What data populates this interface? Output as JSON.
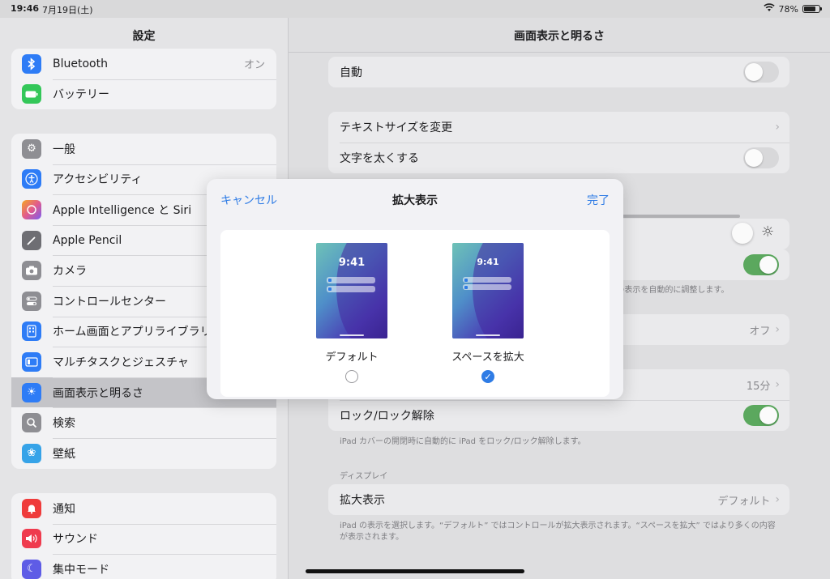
{
  "status_bar": {
    "time": "19:46",
    "date": "7月19日(土)",
    "battery_percent": "78%"
  },
  "sidebar": {
    "title": "設定",
    "groups": [
      {
        "items": [
          {
            "label": "Bluetooth",
            "value": "オン",
            "icon": "bluetooth-icon",
            "color": "#2e7cf6"
          },
          {
            "label": "バッテリー",
            "value": "",
            "icon": "battery-icon",
            "color": "#34c759"
          }
        ]
      },
      {
        "items": [
          {
            "label": "一般",
            "icon": "gear-icon",
            "color": "#8e8e93"
          },
          {
            "label": "アクセシビリティ",
            "icon": "accessibility-icon",
            "color": "#2e7cf6"
          },
          {
            "label": "Apple Intelligence と Siri",
            "icon": "siri-icon",
            "color": "#e25b8c"
          },
          {
            "label": "Apple Pencil",
            "icon": "pencil-icon",
            "color": "#6e6e73"
          },
          {
            "label": "カメラ",
            "icon": "camera-icon",
            "color": "#8e8e93"
          },
          {
            "label": "コントロールセンター",
            "icon": "control-center-icon",
            "color": "#8e8e93"
          },
          {
            "label": "ホーム画面とアプリライブラリ",
            "icon": "home-screen-icon",
            "color": "#2e7cf6"
          },
          {
            "label": "マルチタスクとジェスチャ",
            "icon": "multitask-icon",
            "color": "#2e7cf6"
          },
          {
            "label": "画面表示と明るさ",
            "icon": "brightness-icon",
            "color": "#2e7cf6",
            "selected": true
          },
          {
            "label": "検索",
            "icon": "search-icon",
            "color": "#8e8e93"
          },
          {
            "label": "壁紙",
            "icon": "wallpaper-icon",
            "color": "#36a3e8"
          }
        ]
      },
      {
        "items": [
          {
            "label": "通知",
            "icon": "notification-icon",
            "color": "#ef3b3b"
          },
          {
            "label": "サウンド",
            "icon": "sound-icon",
            "color": "#ef3b4e"
          },
          {
            "label": "集中モード",
            "icon": "focus-icon",
            "color": "#5e5ce6"
          }
        ]
      }
    ]
  },
  "main": {
    "title": "画面表示と明るさ",
    "auto_label": "自動",
    "text_size_label": "テキストサイズを変更",
    "bold_text_label": "文字を太くする",
    "true_tone_note_fragment": "dの表示を自動的に調整します。",
    "night_shift_value": "オフ",
    "auto_lock_value": "15分",
    "lock_unlock_label": "ロック/ロック解除",
    "lock_unlock_note": "iPad カバーの開閉時に自動的に iPad をロック/ロック解除します。",
    "display_section": "ディスプレイ",
    "display_zoom_label": "拡大表示",
    "display_zoom_value": "デフォルト",
    "display_zoom_note": "iPad の表示を選択します。“デフォルト” ではコントロールが拡大表示されます。“スペースを拡大” ではより多くの内容が表示されます。"
  },
  "modal": {
    "cancel": "キャンセル",
    "title": "拡大表示",
    "done": "完了",
    "options": [
      {
        "label": "デフォルト",
        "preview_time": "9:41",
        "selected": false
      },
      {
        "label": "スペースを拡大",
        "preview_time": "9:41",
        "selected": true
      }
    ]
  },
  "colors": {
    "accent": "#2f7ce5",
    "toggle_on": "#5ba85e"
  }
}
